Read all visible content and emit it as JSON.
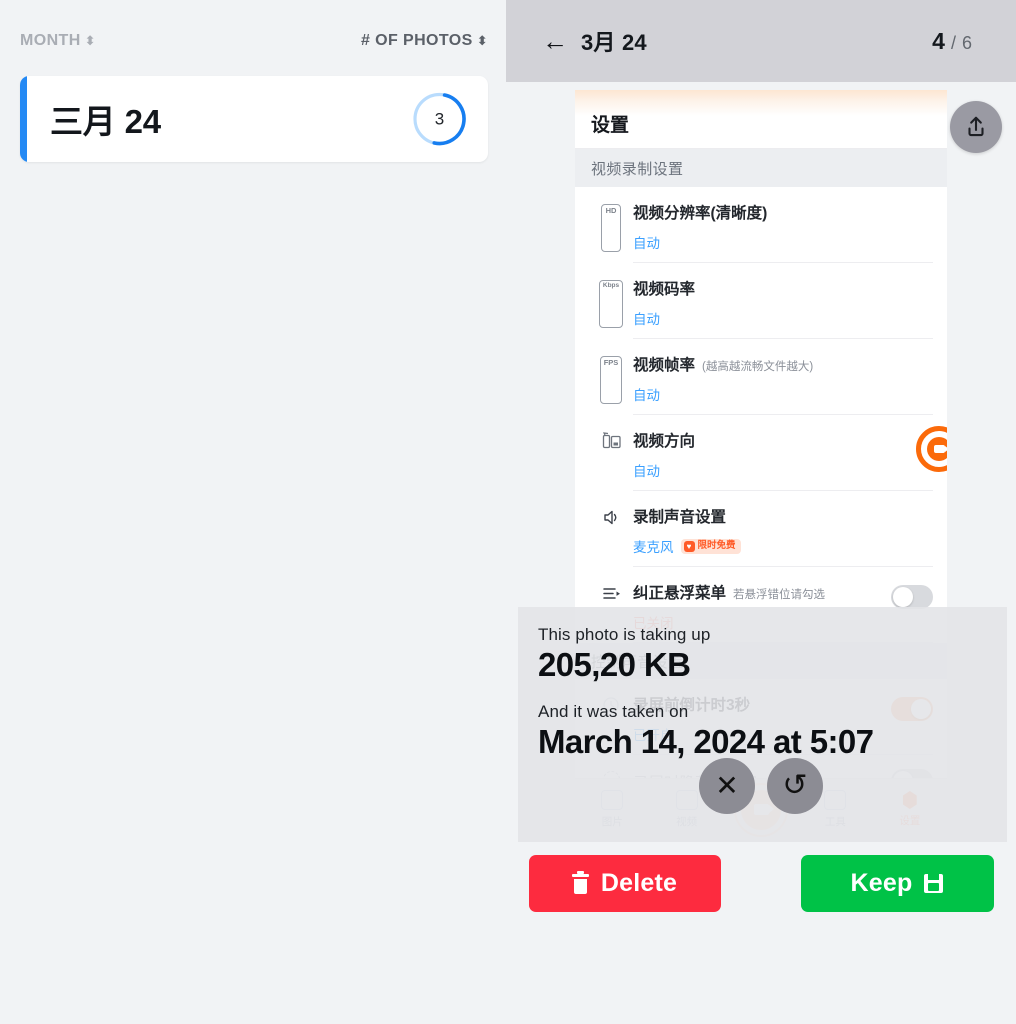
{
  "list": {
    "col_month": "MONTH",
    "col_photos": "# OF PHOTOS",
    "sort_glyph": "⬍",
    "rows": [
      {
        "month": "三月 24",
        "count": "3",
        "progress_pct": 50,
        "accent": "#2489f4"
      }
    ]
  },
  "detail": {
    "back_arrow": "←",
    "title": "3月 24",
    "current": "4",
    "separator": "/",
    "total": "6",
    "share_icon": "upload-icon"
  },
  "photo": {
    "app_title": "设置",
    "section_title": "视频录制设置",
    "rows": [
      {
        "icon": "HD",
        "icon_name": "hd-badge-icon",
        "label": "视频分辨率(清晰度)",
        "hint": "",
        "value": "自动",
        "badge": "",
        "toggle": null
      },
      {
        "icon": "Kbps",
        "icon_name": "bitrate-badge-icon",
        "label": "视频码率",
        "hint": "",
        "value": "自动",
        "badge": "",
        "toggle": null
      },
      {
        "icon": "FPS",
        "icon_name": "fps-badge-icon",
        "label": "视频帧率",
        "hint": "(越高越流畅文件越大)",
        "value": "自动",
        "badge": "",
        "toggle": null
      },
      {
        "icon": "",
        "icon_name": "orientation-icon",
        "label": "视频方向",
        "hint": "",
        "value": "自动",
        "badge": "",
        "toggle": null
      },
      {
        "icon": "",
        "icon_name": "speaker-icon",
        "label": "录制声音设置",
        "hint": "",
        "value": "麦克风",
        "badge": "限时免费",
        "toggle": null
      },
      {
        "icon": "",
        "icon_name": "floating-menu-icon",
        "label": "纠正悬浮菜单",
        "hint": "若悬浮错位请勾选",
        "value": "已关闭",
        "badge": "",
        "toggle": "off"
      }
    ],
    "obscured_section": "控制声音设置",
    "obscured_row_label": "录屏前倒计时3秒",
    "obscured_row_value": "已开启",
    "obscured_toggle": "on",
    "last_row_label": "录屏时隐藏悬浮窗",
    "last_row_toggle": "off",
    "tabs": [
      {
        "label": "图片",
        "icon": "image-icon",
        "active": false
      },
      {
        "label": "视频",
        "icon": "video-icon",
        "active": false
      },
      {
        "label": "",
        "icon": "record-button",
        "active": false
      },
      {
        "label": "工具",
        "icon": "tools-icon",
        "active": false
      },
      {
        "label": "设置",
        "icon": "settings-icon",
        "active": true
      }
    ],
    "float_widget": "floating-record-widget"
  },
  "info": {
    "size_caption": "This photo is taking up",
    "size_value": "205,20 KB",
    "date_caption": "And it was taken on",
    "date_value": "March 14, 2024 at 5:07"
  },
  "actions": {
    "close_glyph": "✕",
    "undo_glyph": "↺",
    "delete_label": "Delete",
    "keep_label": "Keep"
  },
  "colors": {
    "accent_blue": "#2489f4",
    "delete_red": "#fd2b3f",
    "keep_green": "#00c247",
    "orange": "#fb6a0a",
    "header_gray": "#d2d2d7"
  }
}
